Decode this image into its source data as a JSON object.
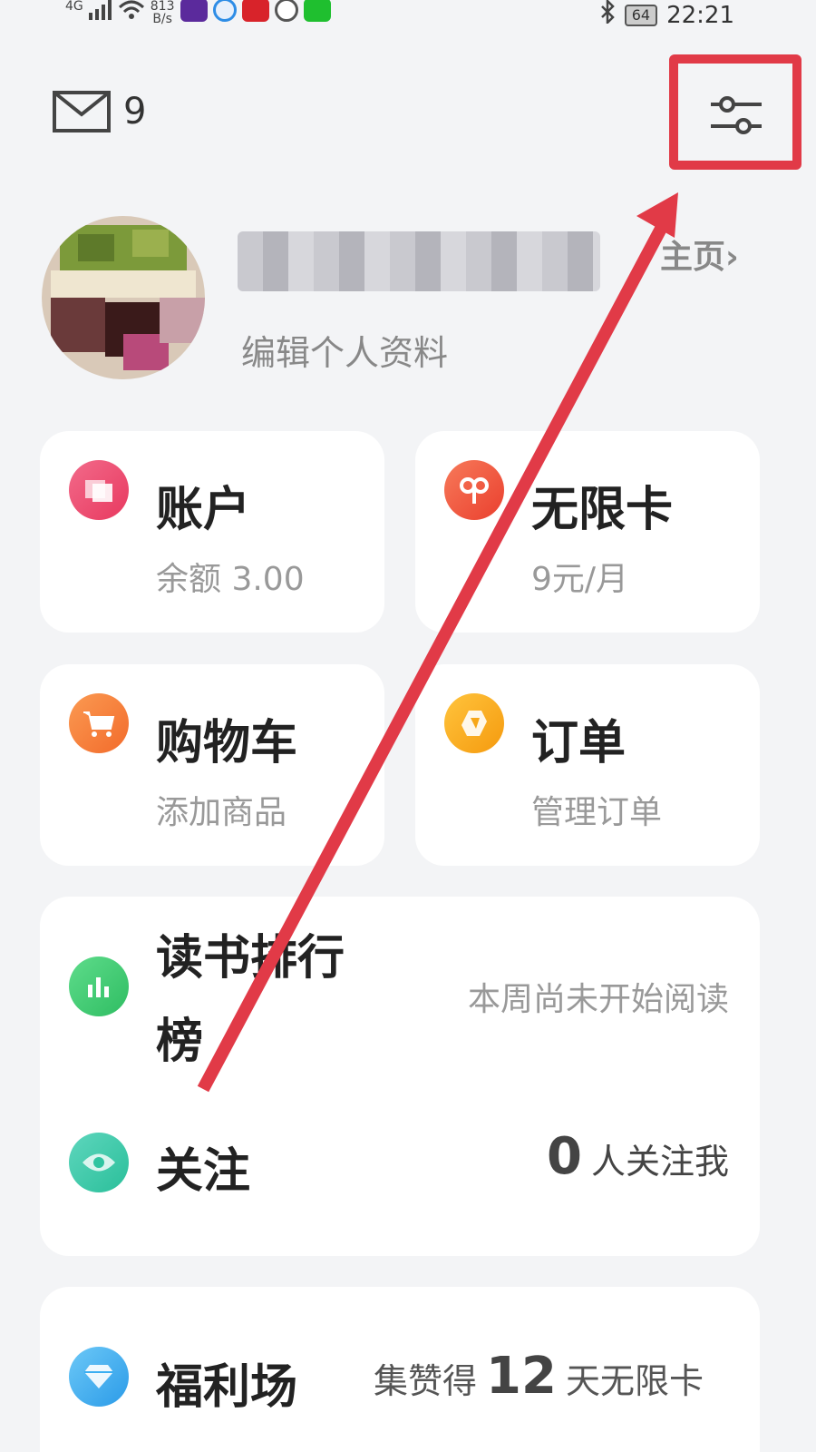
{
  "status_bar": {
    "network": "4G",
    "speed_value": "813",
    "speed_unit": "B/s",
    "battery": "64",
    "time": "22:21"
  },
  "header": {
    "mail_count": "9",
    "settings_icon": "sliders-icon"
  },
  "profile": {
    "edit_label": "编辑个人资料",
    "home_label": "主页",
    "home_chevron": "›"
  },
  "cards": {
    "account": {
      "title": "账户",
      "sub": "余额 3.00",
      "color": "#ef4d75"
    },
    "unlimited": {
      "title": "无限卡",
      "sub": "9元/月",
      "color": "#f0583f"
    },
    "cart": {
      "title": "购物车",
      "sub": "添加商品",
      "color": "#f7813c"
    },
    "orders": {
      "title": "订单",
      "sub": "管理订单",
      "color": "#f8b021"
    }
  },
  "ranking": {
    "title_line1": "读书排行",
    "title_line2": "榜",
    "status": "本周尚未开始阅读",
    "color": "#3cc76e"
  },
  "follow": {
    "title": "关注",
    "count": "0",
    "suffix": "人关注我",
    "color": "#36c9a8"
  },
  "welfare": {
    "title": "福利场",
    "prefix": "集赞得",
    "days": "12",
    "suffix": "天无限卡",
    "color": "#3aaef2"
  },
  "annotation": {
    "box_color": "#e13a47",
    "arrow_color": "#e13a47"
  }
}
